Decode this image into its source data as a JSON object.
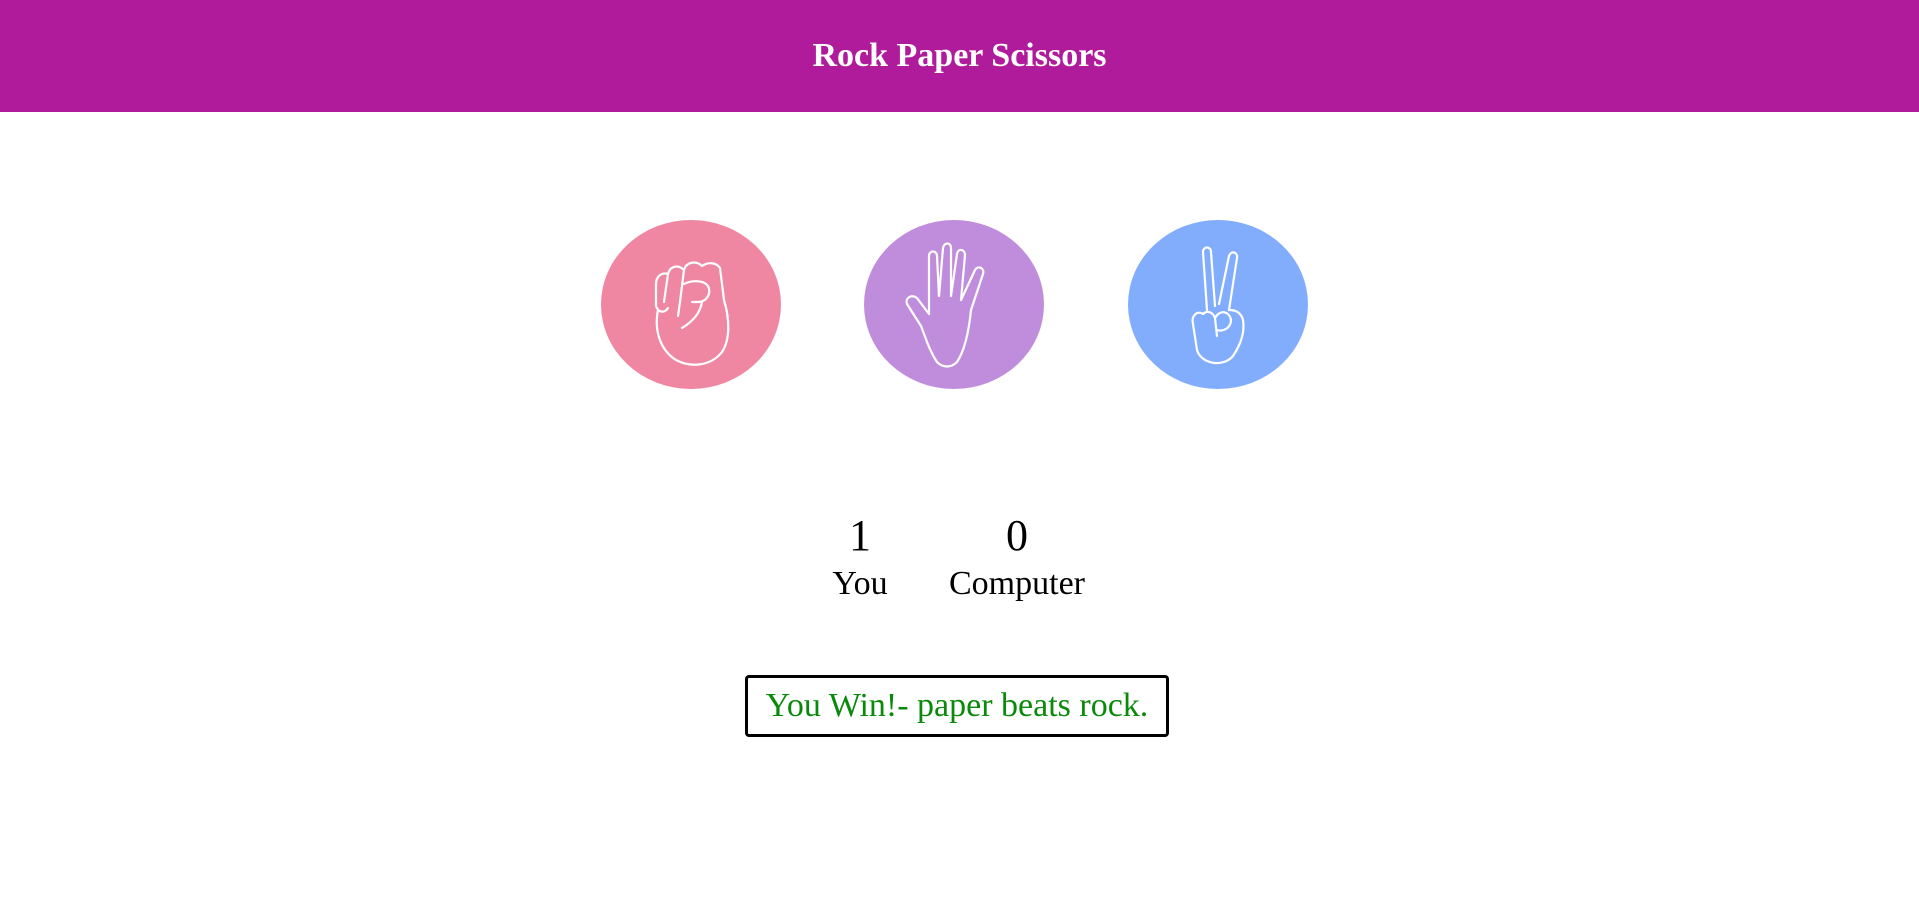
{
  "header": {
    "title": "Rock Paper Scissors"
  },
  "choices": [
    {
      "id": "rock",
      "color": "#f087a2",
      "icon": "fist-icon"
    },
    {
      "id": "paper",
      "color": "#c08ddc",
      "icon": "open-hand-icon"
    },
    {
      "id": "scissors",
      "color": "#82adfd",
      "icon": "peace-sign-icon"
    }
  ],
  "scoreboard": {
    "user": {
      "score": "1",
      "label": "You"
    },
    "computer": {
      "score": "0",
      "label": "Computer"
    }
  },
  "result": {
    "message": "You Win!- paper beats rock.",
    "color": "#0a8a0a"
  }
}
